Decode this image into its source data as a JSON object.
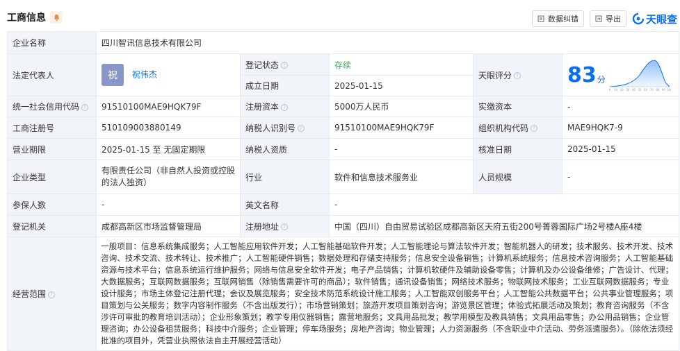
{
  "header": {
    "title": "工商信息",
    "feedback_label": "数据纠错",
    "export_label": "导出",
    "logo_text": "天眼查"
  },
  "rows": {
    "company_name_label": "企业名称",
    "company_name": "四川智讯信息技术有限公司",
    "legal_rep_label": "法定代表人",
    "legal_rep_avatar": "祝",
    "legal_rep_name": "祝伟杰",
    "reg_status_label": "登记状态",
    "reg_status": "存续",
    "est_date_label": "成立日期",
    "est_date": "2025-01-15",
    "tianyan_score_label": "天眼评分",
    "tianyan_score": "83",
    "score_unit": "分",
    "score_axis": [
      "0",
      "10",
      "20",
      "30",
      "40",
      "50",
      "60",
      "70",
      "80",
      "90",
      "100"
    ],
    "credit_code_label": "统一社会信用代码",
    "credit_code": "91510100MAE9HQK79F",
    "reg_capital_label": "注册资本",
    "reg_capital": "5000万人民币",
    "paid_capital_label": "实缴资本",
    "paid_capital": "-",
    "reg_no_label": "工商注册号",
    "reg_no": "510109003880149",
    "taxpayer_id_label": "纳税人识别号",
    "taxpayer_id": "91510100MAE9HQK79F",
    "org_code_label": "组织机构代码",
    "org_code": "MAE9HQK7-9",
    "term_label": "营业期限",
    "term": "2025-01-15 至 无固定期限",
    "taxpayer_qual_label": "纳税人资质",
    "taxpayer_qual": "-",
    "approval_date_label": "核准日期",
    "approval_date": "2025-01-15",
    "company_type_label": "企业类型",
    "company_type": "有限责任公司（非自然人投资或控股的法人独资）",
    "industry_label": "行业",
    "industry": "软件和信息技术服务业",
    "staff_size_label": "人员规模",
    "staff_size": "-",
    "insured_label": "参保人数",
    "insured": "-",
    "english_name_label": "英文名称",
    "english_name": "-",
    "authority_label": "登记机关",
    "authority": "成都高新区市场监督管理局",
    "address_label": "注册地址",
    "address": "中国（四川）自由贸易试验区成都高新区天府五街200号菁蓉国际广场2号楼A座4楼",
    "scope_label": "经营范围",
    "scope": "一般项目：信息系统集成服务；人工智能应用软件开发；人工智能基础软件开发；人工智能理论与算法软件开发；智能机器人的研发；技术服务、技术开发、技术咨询、技术交流、技术转让、技术推广；人工智能硬件销售；数据处理和存储支持服务；信息安全设备销售；计算机系统服务；信息技术咨询服务；人工智能基础资源与技术平台；信息系统运行维护服务；网络与信息安全软件开发；电子产品销售；计算机软硬件及辅助设备零售；计算机及办公设备维修；广告设计、代理；大数据服务；互联网数据服务；互联网销售（除销售需要许可的商品）；软件销售；通讯设备销售；网络技术服务；物联网技术服务；工业互联网数据服务；专业设计服务；市场主体登记注册代理；会议及展览服务；安全技术防范系统设计施工服务；人工智能双创服务平台；人工智能公共数据平台；公共事业管理服务；项目策划与公关服务；数字内容制作服务（不含出版发行）；市场营销策划；旅游开发项目策划咨询；游览景区管理；体验式拓展活动及策划；教育咨询服务（不含涉许可审批的教育培训活动）；企业形象策划；教学专用仪器销售；露营地服务；文具用品批发；教学用模型及教具销售；文具用品零售；办公用品销售；企业管理咨询；办公设备租赁服务；科技中介服务；企业管理；停车场服务；房地产咨询；物业管理；人力资源服务（不含职业中介活动、劳务派遣服务）。（除依法须经批准的项目外，凭营业执照依法自主开展经营活动）"
  },
  "colors": {
    "accent": "#0a6ff0",
    "status_green": "#3aa856",
    "label_bg": "#f1f5fa",
    "border": "#e6ebf2"
  }
}
